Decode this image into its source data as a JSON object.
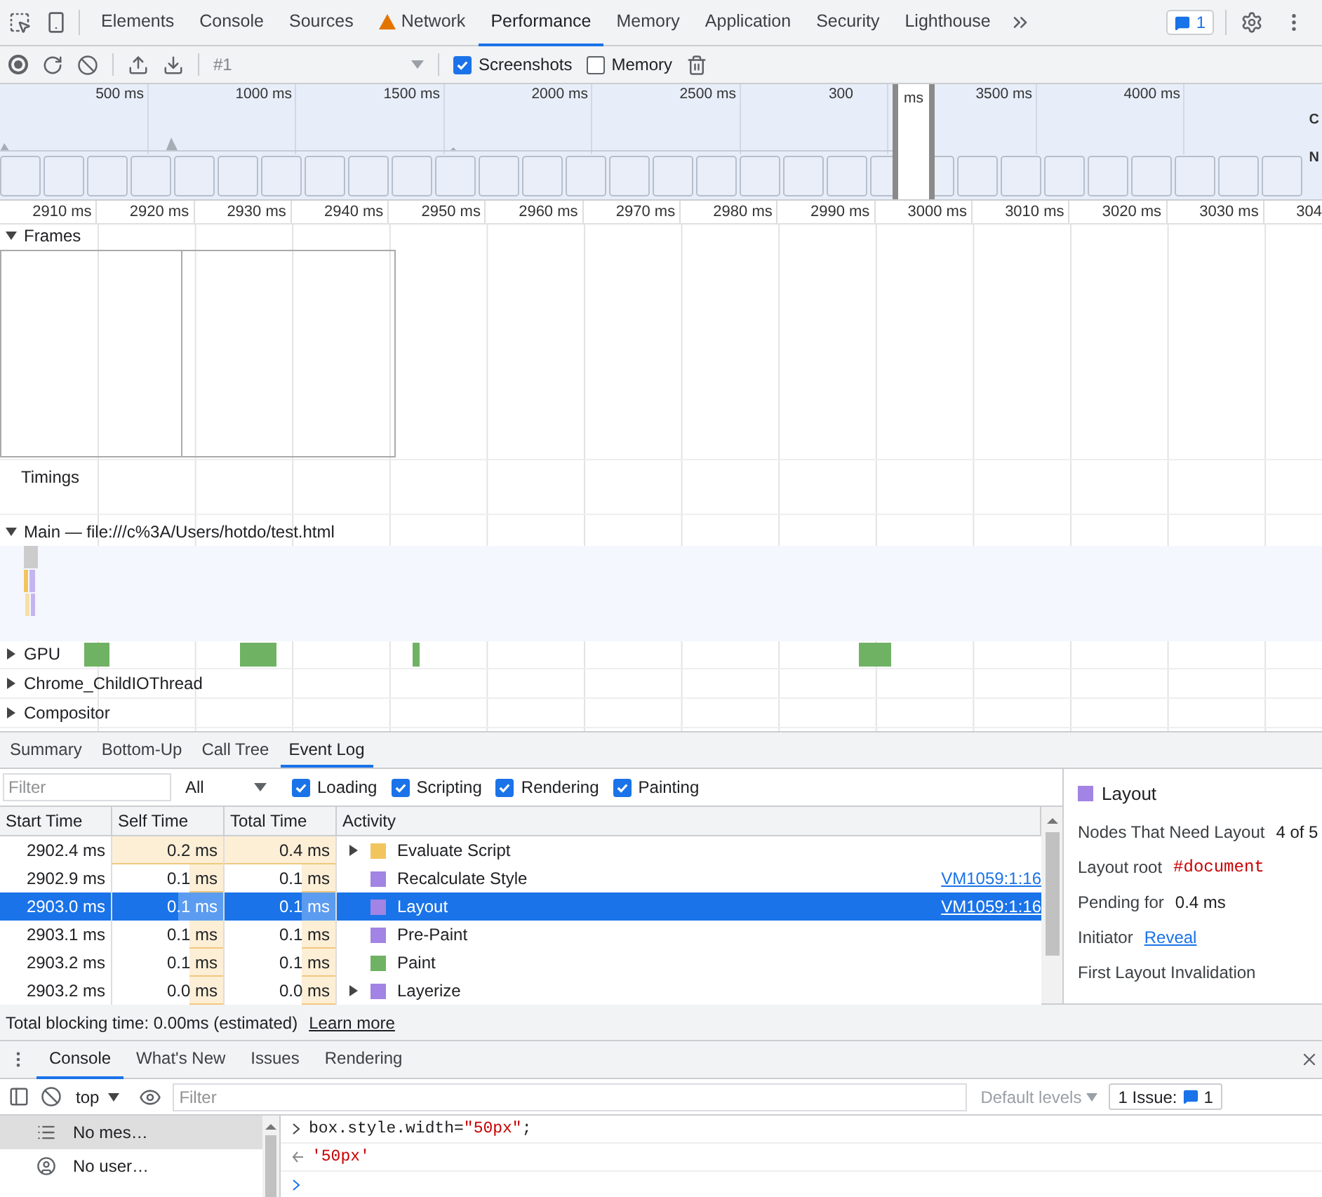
{
  "panel_tabs": [
    {
      "label": "Elements",
      "selected": false,
      "warning": false
    },
    {
      "label": "Console",
      "selected": false,
      "warning": false
    },
    {
      "label": "Sources",
      "selected": false,
      "warning": false
    },
    {
      "label": "Network",
      "selected": false,
      "warning": true
    },
    {
      "label": "Performance",
      "selected": true,
      "warning": false
    },
    {
      "label": "Memory",
      "selected": false,
      "warning": false
    },
    {
      "label": "Application",
      "selected": false,
      "warning": false
    },
    {
      "label": "Security",
      "selected": false,
      "warning": false
    },
    {
      "label": "Lighthouse",
      "selected": false,
      "warning": false
    }
  ],
  "issues_count": "1",
  "toolbar": {
    "recording": "#1",
    "checkboxes": [
      {
        "label": "Screenshots",
        "checked": true
      },
      {
        "label": "Memory",
        "checked": false
      }
    ]
  },
  "overview": {
    "ticks": [
      {
        "label": "500 ms",
        "cut": false
      },
      {
        "label": "1000 ms",
        "cut": false
      },
      {
        "label": "1500 ms",
        "cut": false
      },
      {
        "label": "2000 ms",
        "cut": false
      },
      {
        "label": "2500 ms",
        "cut": false
      },
      {
        "label": "300",
        "cut": true
      },
      {
        "label": "3500 ms",
        "cut": false
      },
      {
        "label": "4000 ms",
        "cut": false
      }
    ],
    "selection_label": "ms",
    "side_labels": [
      "C",
      "N"
    ]
  },
  "ruler": [
    "2910 ms",
    "2920 ms",
    "2930 ms",
    "2940 ms",
    "2950 ms",
    "2960 ms",
    "2970 ms",
    "2980 ms",
    "2990 ms",
    "3000 ms",
    "3010 ms",
    "3020 ms",
    "3030 ms",
    "304"
  ],
  "tracks": [
    {
      "kind": "frames",
      "label": "Frames",
      "expanded": true
    },
    {
      "kind": "timings",
      "label": "Timings"
    },
    {
      "kind": "main",
      "label": "Main — file:///c%3A/Users/hotdo/test.html",
      "expanded": true
    },
    {
      "kind": "gpu",
      "label": "GPU",
      "expanded": false
    },
    {
      "kind": "plain",
      "label": "Chrome_ChildIOThread",
      "expanded": false
    },
    {
      "kind": "plain",
      "label": "Compositor",
      "expanded": false
    }
  ],
  "bottom_tabs": [
    {
      "label": "Summary",
      "selected": false
    },
    {
      "label": "Bottom-Up",
      "selected": false
    },
    {
      "label": "Call Tree",
      "selected": false
    },
    {
      "label": "Event Log",
      "selected": true
    }
  ],
  "filter": {
    "placeholder": "Filter",
    "select": "All",
    "categories": [
      {
        "label": "Loading",
        "checked": true
      },
      {
        "label": "Scripting",
        "checked": true
      },
      {
        "label": "Rendering",
        "checked": true
      },
      {
        "label": "Painting",
        "checked": true
      }
    ]
  },
  "table": {
    "columns": [
      "Start Time",
      "Self Time",
      "Total Time",
      "Activity"
    ],
    "rows": [
      {
        "start": "2902.4 ms",
        "self": {
          "text": "0.2 ms",
          "level": 1
        },
        "total": {
          "text": "0.4 ms",
          "level": 1
        },
        "activity": "Evaluate Script",
        "color": "#f2c55c",
        "expandable": true,
        "selected": false
      },
      {
        "start": "2902.9 ms",
        "self": {
          "text": "0.1 ms",
          "level": 0.3
        },
        "total": {
          "text": "0.1 ms",
          "level": 0.3
        },
        "activity": "Recalculate Style",
        "color": "#a184e3",
        "expandable": false,
        "link": "VM1059:1:16",
        "selected": false
      },
      {
        "start": "2903.0 ms",
        "self": {
          "text": "0.1 ms",
          "level": 0.4
        },
        "total": {
          "text": "0.1 ms",
          "level": 0.3
        },
        "activity": "Layout",
        "color": "#a184e3",
        "expandable": false,
        "link": "VM1059:1:16",
        "selected": true
      },
      {
        "start": "2903.1 ms",
        "self": {
          "text": "0.1 ms",
          "level": 0.3
        },
        "total": {
          "text": "0.1 ms",
          "level": 0.3
        },
        "activity": "Pre-Paint",
        "color": "#a184e3",
        "expandable": false,
        "selected": false
      },
      {
        "start": "2903.2 ms",
        "self": {
          "text": "0.1 ms",
          "level": 0.3
        },
        "total": {
          "text": "0.1 ms",
          "level": 0.3
        },
        "activity": "Paint",
        "color": "#6fb264",
        "expandable": false,
        "selected": false
      },
      {
        "start": "2903.2 ms",
        "self": {
          "text": "0.0 ms",
          "level": 0.3
        },
        "total": {
          "text": "0.0 ms",
          "level": 0.3
        },
        "activity": "Layerize",
        "color": "#a184e3",
        "expandable": true,
        "selected": false
      }
    ]
  },
  "details": {
    "title": "Layout",
    "color": "#a184e3",
    "fields": [
      {
        "kind": "text",
        "label": "Nodes That Need Layout",
        "value": "4 of 5"
      },
      {
        "kind": "code",
        "label": "Layout root",
        "value": "#document"
      },
      {
        "kind": "text",
        "label": "Pending for",
        "value": "0.4 ms"
      },
      {
        "kind": "link",
        "label": "Initiator",
        "value": "Reveal"
      },
      {
        "kind": "heading",
        "label": "First Layout Invalidation"
      }
    ]
  },
  "status": {
    "text": "Total blocking time: 0.00ms (estimated)",
    "link": "Learn more"
  },
  "drawer_tabs": [
    {
      "label": "Console",
      "selected": true
    },
    {
      "label": "What's New",
      "selected": false
    },
    {
      "label": "Issues",
      "selected": false
    },
    {
      "label": "Rendering",
      "selected": false
    }
  ],
  "console_toolbar": {
    "context": "top",
    "filter_placeholder": "Filter",
    "levels": "Default levels",
    "issues_label": "1 Issue:",
    "issues_count": "1"
  },
  "console_sidebar": [
    {
      "kind": "messages",
      "label": "No mes…",
      "selected": true
    },
    {
      "kind": "user",
      "label": "No user…",
      "selected": false
    }
  ],
  "console_lines": [
    {
      "kind": "input",
      "code": "box.style.width=",
      "string": "\"50px\"",
      "tail": ";"
    },
    {
      "kind": "output",
      "string": "'50px'"
    }
  ]
}
